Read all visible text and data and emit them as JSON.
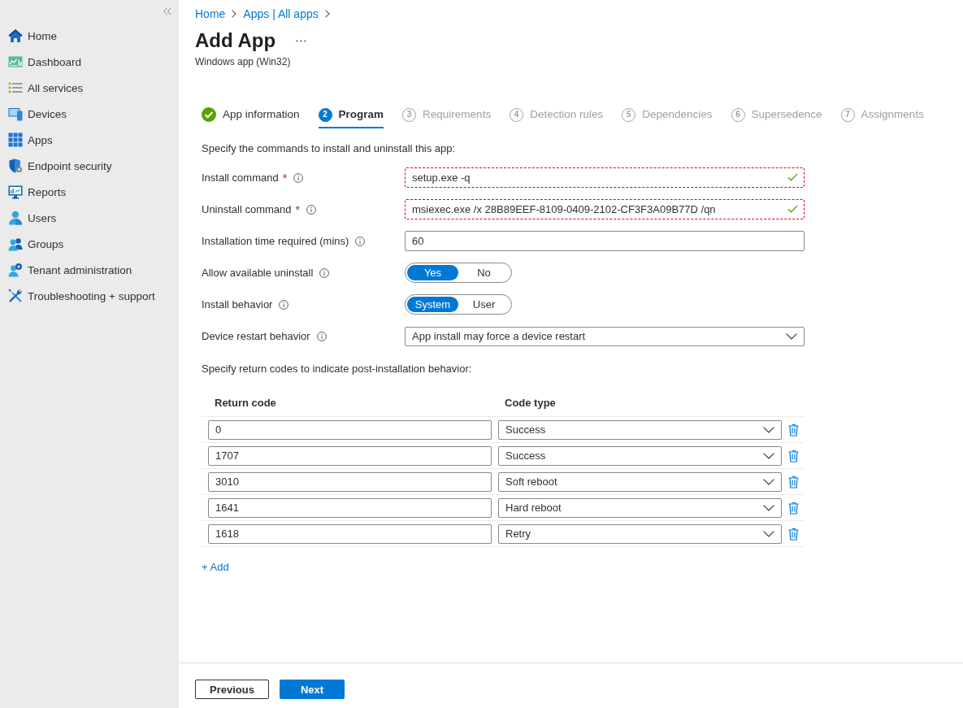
{
  "sidebar": {
    "items": [
      {
        "label": "Home"
      },
      {
        "label": "Dashboard"
      },
      {
        "label": "All services"
      },
      {
        "label": "Devices"
      },
      {
        "label": "Apps"
      },
      {
        "label": "Endpoint security"
      },
      {
        "label": "Reports"
      },
      {
        "label": "Users"
      },
      {
        "label": "Groups"
      },
      {
        "label": "Tenant administration"
      },
      {
        "label": "Troubleshooting + support"
      }
    ]
  },
  "breadcrumb": [
    "Home",
    "Apps | All apps"
  ],
  "page": {
    "title": "Add App",
    "subtitle": "Windows app (Win32)"
  },
  "steps": [
    {
      "label": "App information",
      "completed": true,
      "selected": false
    },
    {
      "number": "2",
      "label": "Program",
      "completed": false,
      "selected": true
    },
    {
      "number": "3",
      "label": "Requirements",
      "completed": false,
      "selected": false
    },
    {
      "number": "4",
      "label": "Detection rules",
      "completed": false,
      "selected": false
    },
    {
      "number": "5",
      "label": "Dependencies",
      "completed": false,
      "selected": false
    },
    {
      "number": "6",
      "label": "Supersedence",
      "completed": false,
      "selected": false
    },
    {
      "number": "7",
      "label": "Assignments",
      "completed": false,
      "selected": false
    }
  ],
  "program": {
    "intro": "Specify the commands to install and uninstall this app:",
    "fields": [
      {
        "kind": "text",
        "label": "Install command",
        "required_mark": "*",
        "value": "setup.exe -q",
        "highlighted": true,
        "valid": true
      },
      {
        "kind": "text",
        "label": "Uninstall command",
        "required_mark": "*",
        "value": "msiexec.exe /x 28B89EEF-8109-0409-2102-CF3F3A09B77D /qn",
        "highlighted": true,
        "valid": true
      },
      {
        "kind": "text",
        "label": "Installation time required (mins)",
        "value": "60",
        "highlighted": false,
        "valid": false
      },
      {
        "kind": "toggle",
        "label": "Allow available uninstall",
        "options": [
          {
            "label": "Yes",
            "selected": true
          },
          {
            "label": "No",
            "selected": false
          }
        ]
      },
      {
        "kind": "toggle",
        "label": "Install behavior",
        "options": [
          {
            "label": "System",
            "selected": true
          },
          {
            "label": "User",
            "selected": false
          }
        ]
      },
      {
        "kind": "select",
        "label": "Device restart behavior",
        "value": "App install may force a device restart"
      }
    ]
  },
  "return_codes": {
    "intro": "Specify return codes to indicate post-installation behavior:",
    "columns": [
      "Return code",
      "Code type"
    ],
    "rows": [
      {
        "code": "0",
        "type": "Success"
      },
      {
        "code": "1707",
        "type": "Success"
      },
      {
        "code": "3010",
        "type": "Soft reboot"
      },
      {
        "code": "1641",
        "type": "Hard reboot"
      },
      {
        "code": "1618",
        "type": "Retry"
      }
    ],
    "add_link": "+ Add"
  },
  "footer": {
    "buttons": [
      {
        "label": "Previous",
        "kind": "secondary"
      },
      {
        "label": "Next",
        "kind": "primary"
      }
    ]
  }
}
